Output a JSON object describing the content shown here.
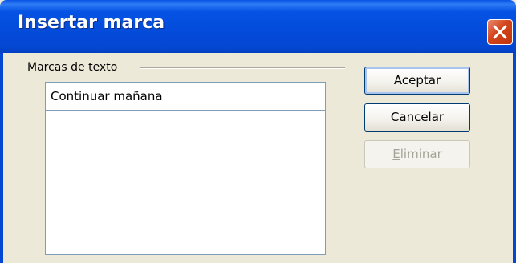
{
  "window": {
    "title": "Insertar marca",
    "close_icon": "close-icon"
  },
  "group": {
    "label": "Marcas de texto"
  },
  "input": {
    "value": "Continuar mañana"
  },
  "buttons": {
    "accept": "Aceptar",
    "cancel": "Cancelar",
    "delete_mnemonic": "E",
    "delete_rest": "liminar"
  },
  "colors": {
    "titlebar": "#0447d3",
    "close_button": "#d2441c",
    "dialog_bg": "#ece9d8",
    "disabled_text": "#a6a397"
  }
}
